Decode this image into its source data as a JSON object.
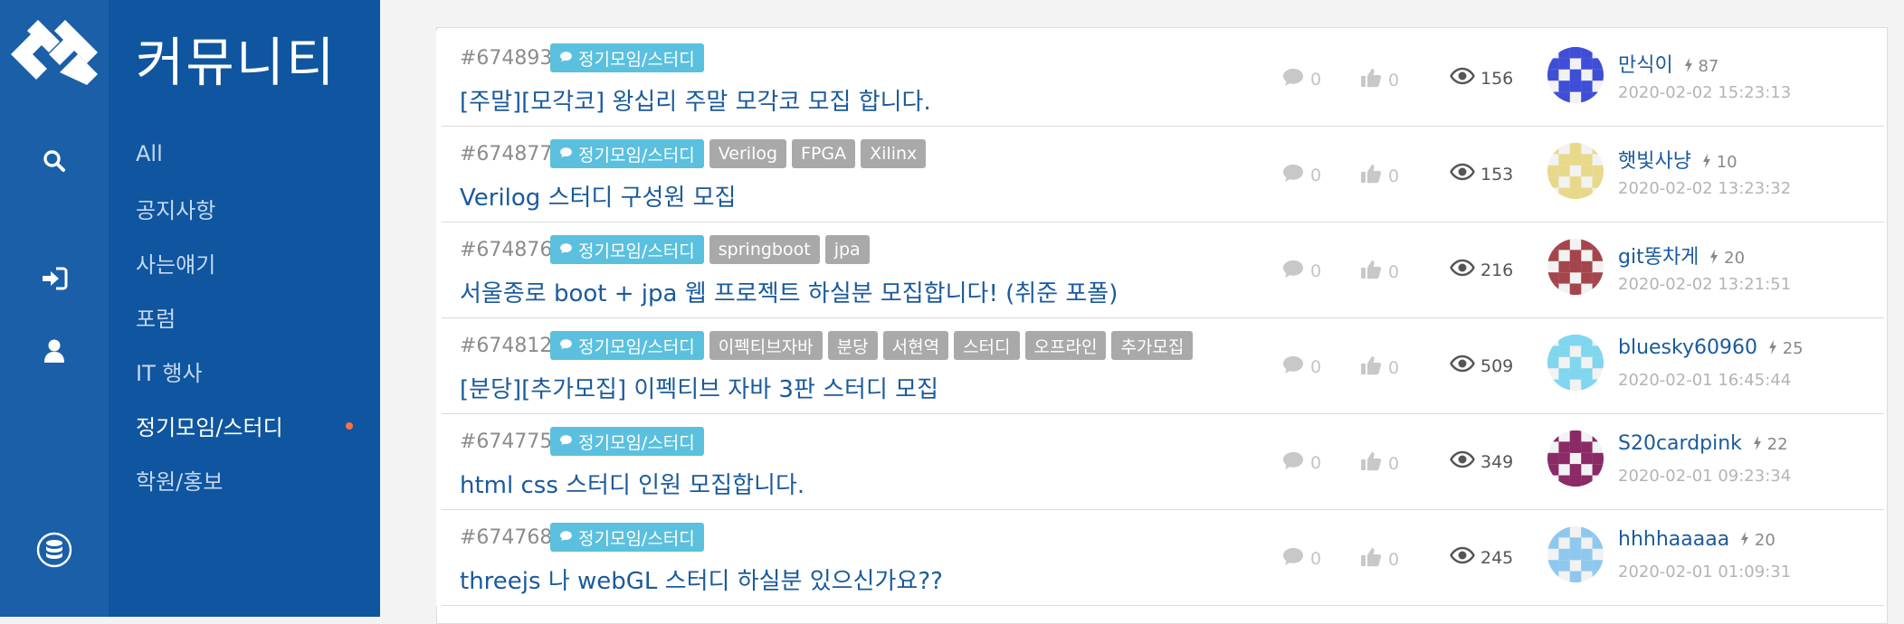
{
  "sidebar": {
    "title": "커뮤니티",
    "items": [
      {
        "label": "All"
      },
      {
        "label": "공지사항"
      },
      {
        "label": "사는얘기"
      },
      {
        "label": "포럼"
      },
      {
        "label": "IT 행사"
      },
      {
        "label": "정기모임/스터디",
        "active": true
      },
      {
        "label": "학원/홍보"
      }
    ]
  },
  "iconbar": {
    "icons": [
      "logo-icon",
      "search-icon",
      "sign-in-icon",
      "user-icon",
      "database-icon"
    ]
  },
  "posts": [
    {
      "id": "#674893",
      "category": "정기모임/스터디",
      "tags": [],
      "title": "[주말][모각코] 왕십리 주말 모각코 모집 합니다.",
      "comments": "0",
      "likes": "0",
      "views": "156",
      "author": "만식이",
      "rep": "87",
      "date": "2020-02-02 15:23:13"
    },
    {
      "id": "#674877",
      "category": "정기모임/스터디",
      "tags": [
        "Verilog",
        "FPGA",
        "Xilinx"
      ],
      "title": "Verilog 스터디 구성원 모집",
      "comments": "0",
      "likes": "0",
      "views": "153",
      "author": "햇빛사냥",
      "rep": "10",
      "date": "2020-02-02 13:23:32"
    },
    {
      "id": "#674876",
      "category": "정기모임/스터디",
      "tags": [
        "springboot",
        "jpa"
      ],
      "title": "서울종로 boot + jpa 웹 프로젝트 하실분 모집합니다! (취준 포폴)",
      "comments": "0",
      "likes": "0",
      "views": "216",
      "author": "git똥차게",
      "rep": "20",
      "date": "2020-02-02 13:21:51"
    },
    {
      "id": "#674812",
      "category": "정기모임/스터디",
      "tags": [
        "이펙티브자바",
        "분당",
        "서현역",
        "스터디",
        "오프라인",
        "추가모집"
      ],
      "title": "[분당][추가모집] 이펙티브 자바 3판 스터디 모집",
      "comments": "0",
      "likes": "0",
      "views": "509",
      "author": "bluesky60960",
      "rep": "25",
      "date": "2020-02-01 16:45:44"
    },
    {
      "id": "#674775",
      "category": "정기모임/스터디",
      "tags": [],
      "title": "html css 스터디 인원 모집합니다.",
      "comments": "0",
      "likes": "0",
      "views": "349",
      "author": "S20cardpink",
      "rep": "22",
      "date": "2020-02-01 09:23:34"
    },
    {
      "id": "#674768",
      "category": "정기모임/스터디",
      "tags": [],
      "title": "threejs 나 webGL 스터디 하실분 있으신가요??",
      "comments": "0",
      "likes": "0",
      "views": "245",
      "author": "hhhhaaaaa",
      "rep": "20",
      "date": "2020-02-01 01:09:31"
    }
  ],
  "colors": {
    "iconbar": "#1a5fa8",
    "sidebar": "#0f559f",
    "link": "#1a5a9c",
    "category_tag": "#5bc0de",
    "tag": "#a9a9a9",
    "active_dot": "#ff7043"
  }
}
